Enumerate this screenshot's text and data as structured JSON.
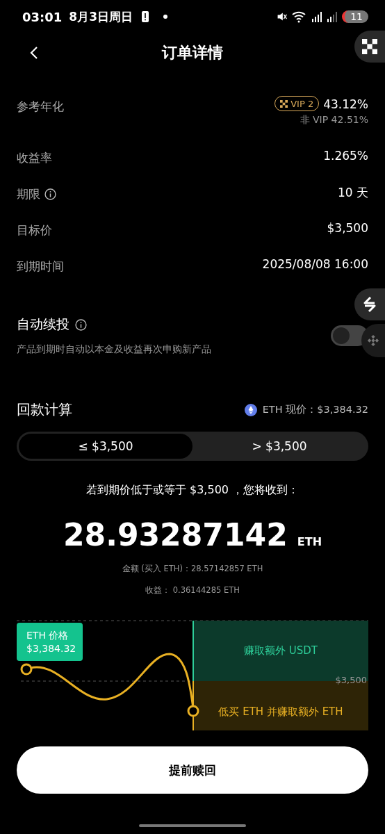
{
  "status_bar": {
    "time": "03:01",
    "date": "8月3日周日",
    "notification_count": "11"
  },
  "header": {
    "title": "订单详情"
  },
  "details": [
    {
      "label": "参考年化",
      "value": "43.12%",
      "badge": "VIP 2",
      "note": "非 VIP 42.51%",
      "info": false
    },
    {
      "label": "收益率",
      "value": "1.265%",
      "info": false
    },
    {
      "label": "期限",
      "value": "10 天",
      "info": true
    },
    {
      "label": "目标价",
      "value": "$3,500",
      "info": false
    },
    {
      "label": "到期时间",
      "value": "2025/08/08 16:00",
      "info": false
    }
  ],
  "auto_renew": {
    "label": "自动续投",
    "info": true,
    "description": "产品到期时自动以本金及收益再次申购新产品",
    "on": false
  },
  "payout": {
    "title": "回款计算",
    "price_label": "ETH 现价：$3,384.32",
    "tabs": [
      {
        "label": "≤ $3,500",
        "selected": true
      },
      {
        "label": "> $3,500",
        "selected": false
      }
    ],
    "sentence": "若到期价低于或等于 $3,500 ，您将收到：",
    "amount": "28.93287142",
    "unit": "ETH",
    "lines": [
      "金额 (买入 ETH)：28.57142857 ETH",
      "收益： 0.36144285 ETH"
    ]
  },
  "diagram": {
    "price_tag": [
      "ETH 价格",
      "$3,384.32"
    ],
    "strike_label": "$3,500",
    "upper_zone": "赚取额外 USDT",
    "lower_zone": "低买 ETH 并赚取额外 ETH"
  },
  "redeem_button": "提前赎回"
}
